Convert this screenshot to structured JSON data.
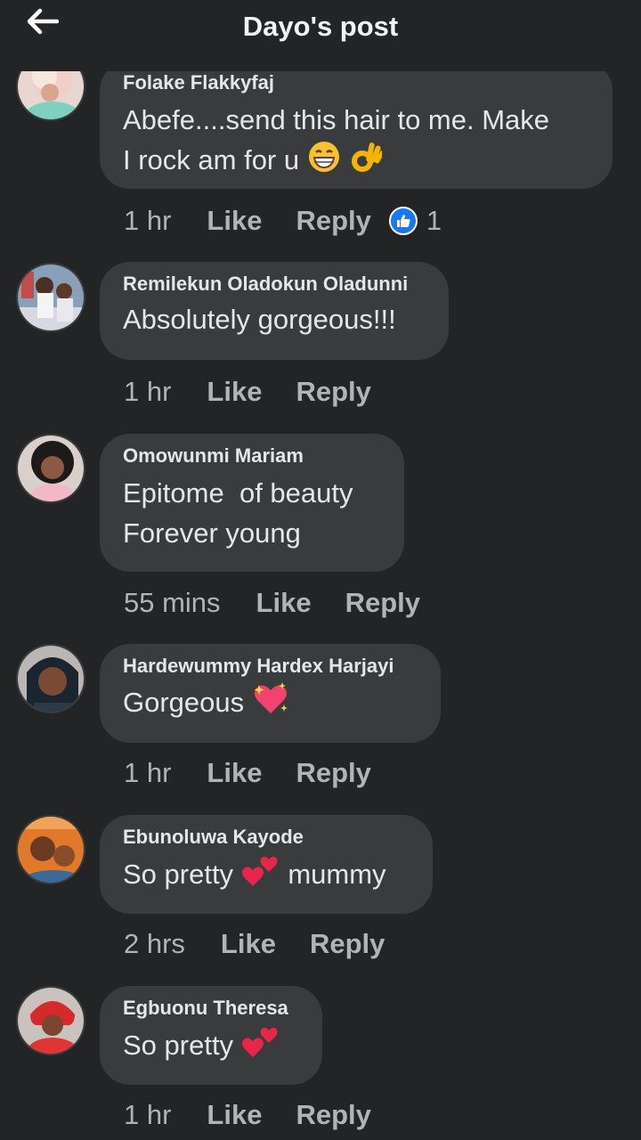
{
  "header": {
    "title": "Dayo's post"
  },
  "comments": [
    {
      "author": "Folake Flakkyfaj",
      "line1": "Abefe....send this hair to me. Make",
      "line2": "I rock am for u",
      "time": "1 hr",
      "like": "Like",
      "reply": "Reply",
      "reaction_count": "1",
      "emojis": [
        "grinning-face-emoji",
        "ok-hand-emoji"
      ]
    },
    {
      "author": "Remilekun Oladokun Oladunni",
      "line1": "Absolutely gorgeous!!!",
      "time": "1 hr",
      "like": "Like",
      "reply": "Reply"
    },
    {
      "author": "Omowunmi Mariam",
      "line1": "Epitome  of beauty",
      "line2": "Forever young",
      "time": "55 mins",
      "like": "Like",
      "reply": "Reply"
    },
    {
      "author": "Hardewummy Hardex Harjayi",
      "line1": "Gorgeous",
      "time": "1 hr",
      "like": "Like",
      "reply": "Reply",
      "emojis": [
        "sparkling-heart-emoji"
      ]
    },
    {
      "author": "Ebunoluwa Kayode",
      "line1_a": "So pretty",
      "line1_b": "mummy",
      "time": "2 hrs",
      "like": "Like",
      "reply": "Reply",
      "emojis": [
        "two-hearts-emoji"
      ]
    },
    {
      "author": "Egbuonu Theresa",
      "line1": "So pretty",
      "time": "1 hr",
      "like": "Like",
      "reply": "Reply",
      "emojis": [
        "two-hearts-emoji"
      ]
    }
  ],
  "colors": {
    "background": "#232425",
    "bubble": "#3a3b3c",
    "primary_text": "#e4e6eb",
    "secondary_text": "#b0b3b8",
    "like_reaction": "#1877f2"
  },
  "icons": [
    "back-arrow-icon",
    "like-reaction-icon"
  ]
}
